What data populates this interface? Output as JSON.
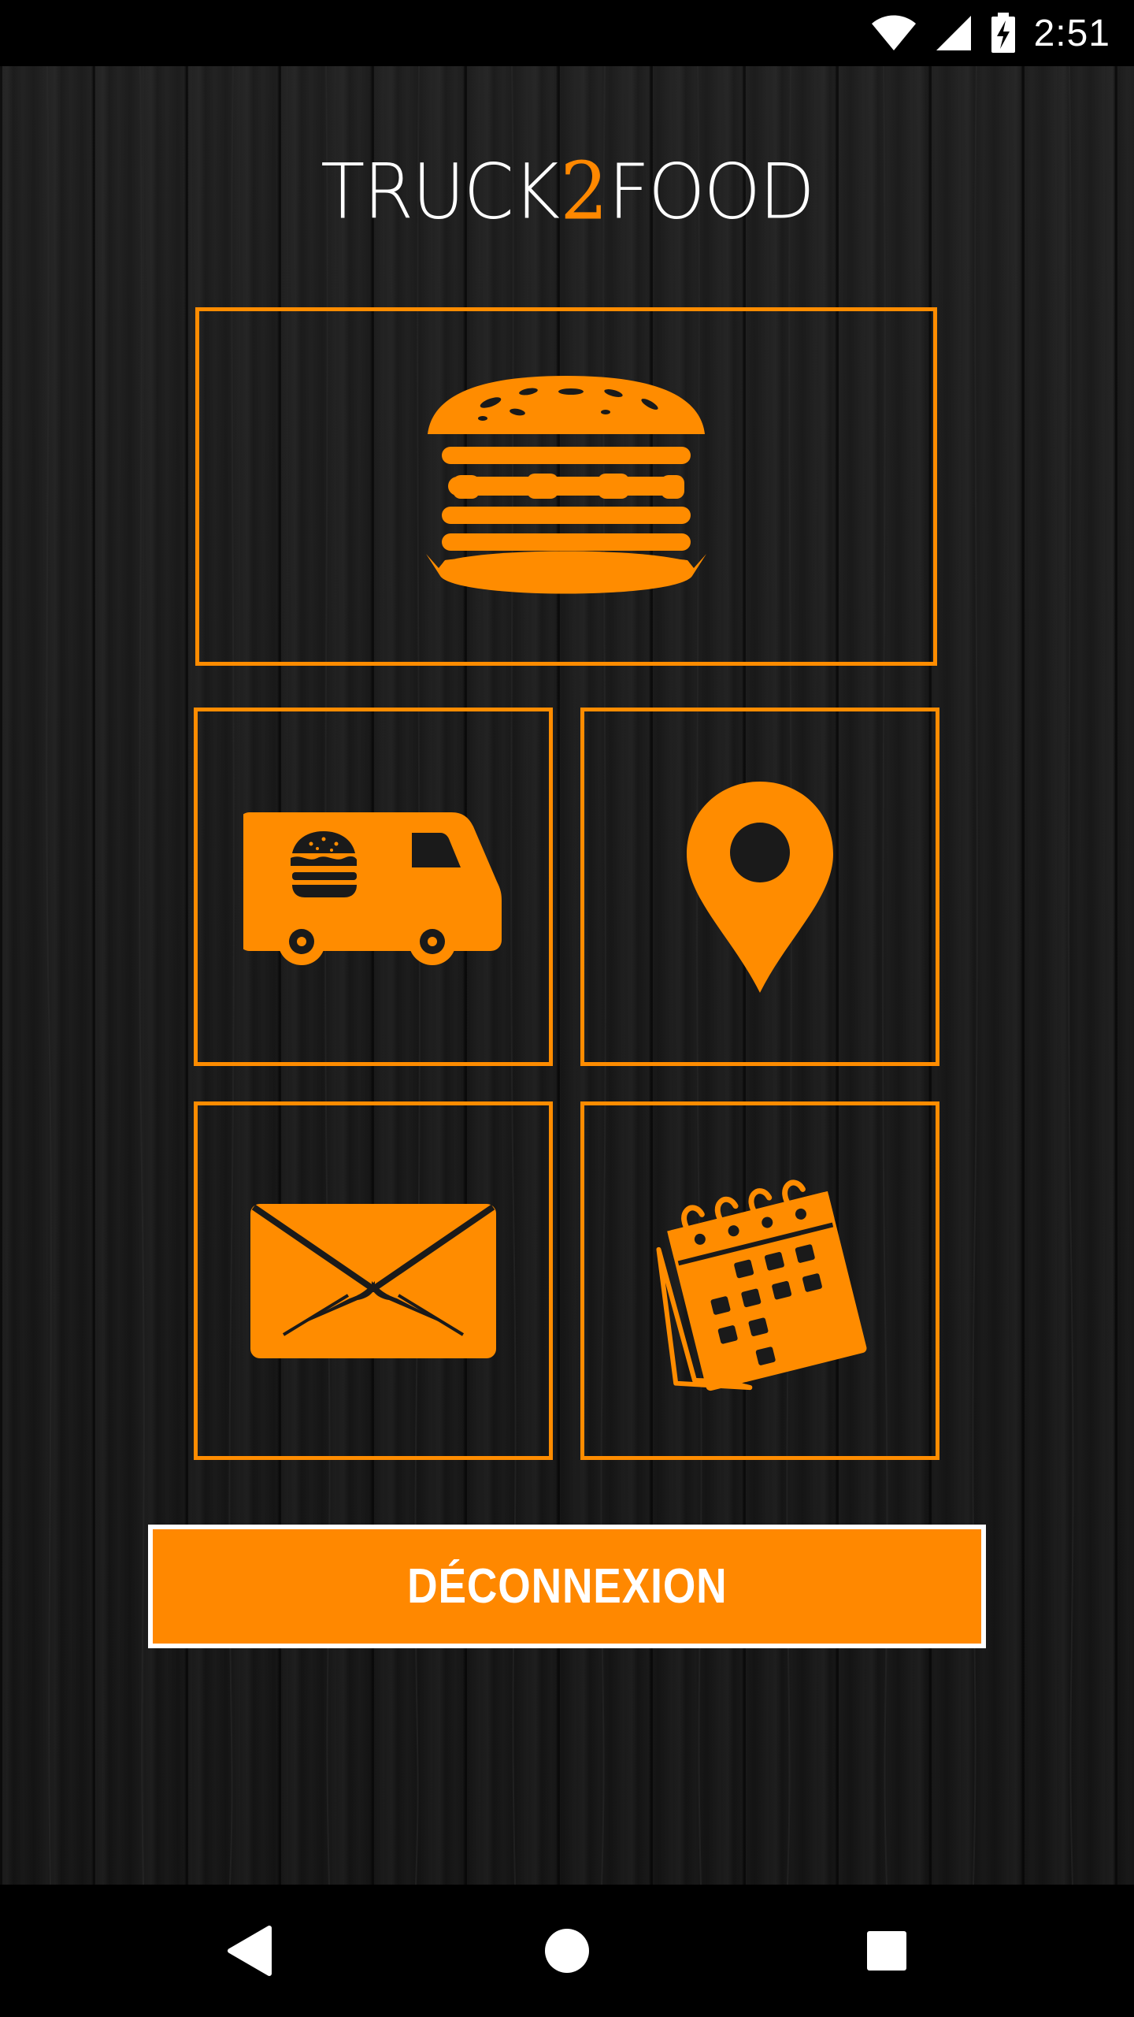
{
  "status_bar": {
    "time": "2:51",
    "icons": [
      "wifi-icon",
      "cell-signal-icon",
      "battery-charging-icon"
    ]
  },
  "app": {
    "logo_part1": "TRUCK",
    "logo_part2": "2",
    "logo_part3": "FOOD"
  },
  "tiles": [
    {
      "id": "menu",
      "icon": "burger-icon"
    },
    {
      "id": "trucks",
      "icon": "food-truck-icon"
    },
    {
      "id": "location",
      "icon": "location-pin-icon"
    },
    {
      "id": "contact",
      "icon": "envelope-icon"
    },
    {
      "id": "calendar",
      "icon": "calendar-icon"
    }
  ],
  "logout_button": {
    "label": "DÉCONNEXION"
  },
  "nav_bar": {
    "buttons": [
      "back-icon",
      "home-icon",
      "recents-icon"
    ]
  },
  "colors": {
    "accent": "#ff8c00",
    "button_bg": "#ff8800",
    "background": "#161616",
    "text": "#ffffff"
  }
}
